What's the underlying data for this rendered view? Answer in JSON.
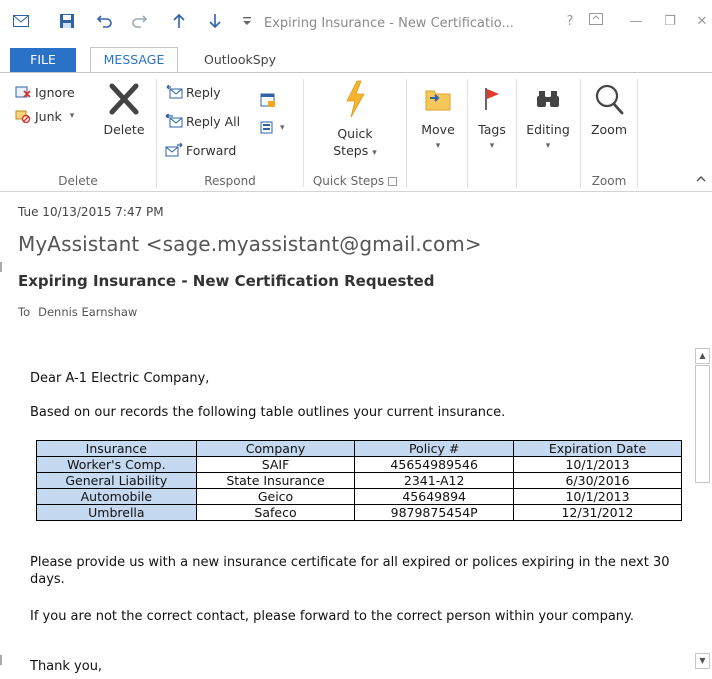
{
  "window": {
    "title": "Expiring Insurance - New Certificatio...",
    "help": "?",
    "minimize": "—",
    "restore": "❐",
    "close": "✕"
  },
  "tabs": {
    "file": "FILE",
    "message": "MESSAGE",
    "outlookspy": "OutlookSpy"
  },
  "ribbon": {
    "delete_group": {
      "ignore": "Ignore",
      "junk": "Junk",
      "delete": "Delete",
      "label": "Delete"
    },
    "respond_group": {
      "reply": "Reply",
      "reply_all": "Reply All",
      "forward": "Forward",
      "label": "Respond"
    },
    "quick_steps_group": {
      "button_line1": "Quick",
      "button_line2": "Steps",
      "label": "Quick Steps"
    },
    "move": "Move",
    "tags": "Tags",
    "editing": "Editing",
    "zoom_group": {
      "zoom": "Zoom",
      "label": "Zoom"
    }
  },
  "header": {
    "date": "Tue 10/13/2015 7:47 PM",
    "from": "MyAssistant <sage.myassistant@gmail.com>",
    "subject": "Expiring Insurance - New Certification Requested",
    "to_label": "To",
    "to_name": "Dennis Earnshaw"
  },
  "body": {
    "greeting": "Dear A-1 Electric Company,",
    "intro": "Based on our records the following table outlines your current insurance.",
    "request": "Please provide us with a new insurance certificate for all expired or polices expiring in the next 30 days.",
    "forward_note": "If you are not the correct contact, please forward to the correct person within your company.",
    "closing": "Thank you,"
  },
  "table": {
    "headers": [
      "Insurance",
      "Company",
      "Policy #",
      "Expiration Date"
    ],
    "rows": [
      [
        "Worker's Comp.",
        "SAIF",
        "45654989546",
        "10/1/2013"
      ],
      [
        "General Liability",
        "State Insurance",
        "2341-A12",
        "6/30/2016"
      ],
      [
        "Automobile",
        "Geico",
        "45649894",
        "10/1/2013"
      ],
      [
        "Umbrella",
        "Safeco",
        "9879875454P",
        "12/31/2012"
      ]
    ]
  },
  "colors": {
    "accent": "#2a72c7",
    "table_header": "#c5d9f1",
    "flag_red": "#e03a2e",
    "quick_steps": "#f5b52e"
  }
}
